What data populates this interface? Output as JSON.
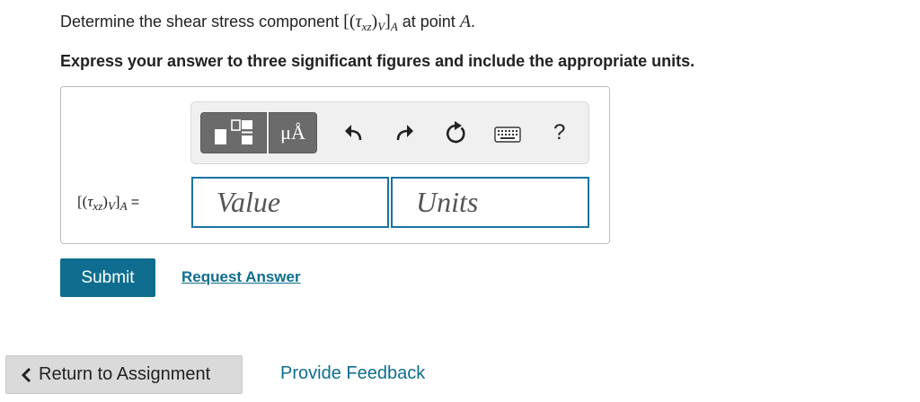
{
  "question": {
    "prompt_pre": "Determine the shear stress component",
    "prompt_post": "at point",
    "point": "A",
    "point_end": ".",
    "math": {
      "open": "[(",
      "tau": "τ",
      "tau_sub": "xz",
      "close_paren": ")",
      "v_sub": "V",
      "close_bracket": "]",
      "a_sub": "A"
    },
    "instruction": "Express your answer to three significant figures and include the appropriate units."
  },
  "toolbar": {
    "templates_icon": "templates-icon",
    "units_label": "μÅ",
    "undo_icon": "undo-icon",
    "redo_icon": "redo-icon",
    "reset_icon": "reset-icon",
    "keyboard_icon": "keyboard-icon",
    "help_label": "?"
  },
  "answer": {
    "label_equals": "=",
    "value_placeholder": "Value",
    "units_placeholder": "Units"
  },
  "actions": {
    "submit": "Submit",
    "request_answer": "Request Answer",
    "return": "Return to Assignment",
    "feedback": "Provide Feedback"
  },
  "colors": {
    "accent": "#0f6e8f",
    "field_border": "#1a74a0",
    "tool_button": "#6b6b6b"
  }
}
